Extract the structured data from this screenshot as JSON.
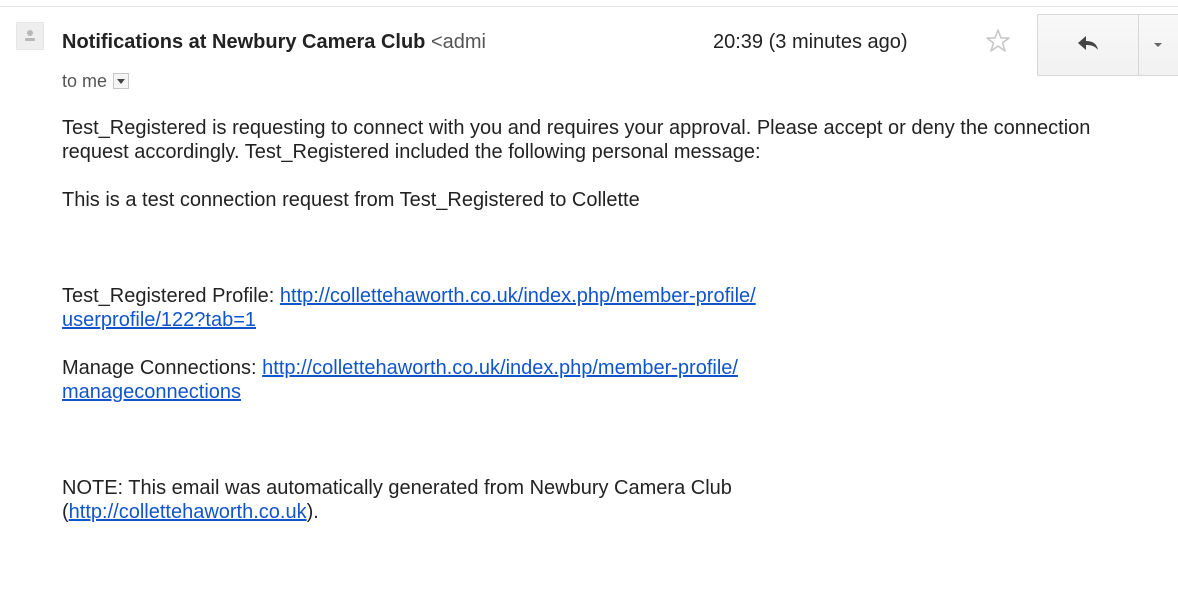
{
  "header": {
    "sender_name": "Notifications at Newbury Camera Club",
    "sender_email_truncated": "<admi",
    "timestamp": "20:39 (3 minutes ago)",
    "recipient": "to me"
  },
  "icons": {
    "avatar": "person-silhouette-icon",
    "star": "star-outline-icon",
    "reply": "reply-arrow-icon",
    "more": "caret-down-icon",
    "recipient_toggle": "small-caret-down-icon"
  },
  "body": {
    "paragraph1": "Test_Registered is requesting to connect with you and requires your approval.  Please accept or deny the connection request accordingly.  Test_Registered included the following personal message:",
    "paragraph2": "This is a test connection request from Test_Registered to Collette",
    "profile_label": "Test_Registered Profile: ",
    "profile_link_part1": "http://collettehaworth.co.uk/index.php/member-profile/",
    "profile_link_part2": "userprofile/122?tab=1",
    "manage_label": "Manage Connections: ",
    "manage_link_part1": "http://collettehaworth.co.uk/index.php/member-profile/",
    "manage_link_part2": "manageconnections",
    "note_text": "NOTE: This email was automatically generated from Newbury Camera Club",
    "note_paren_open": "(",
    "note_link": "http://collettehaworth.co.uk",
    "note_paren_close": ")."
  },
  "colors": {
    "link": "#1155cc",
    "text": "#222222",
    "muted": "#555555"
  }
}
